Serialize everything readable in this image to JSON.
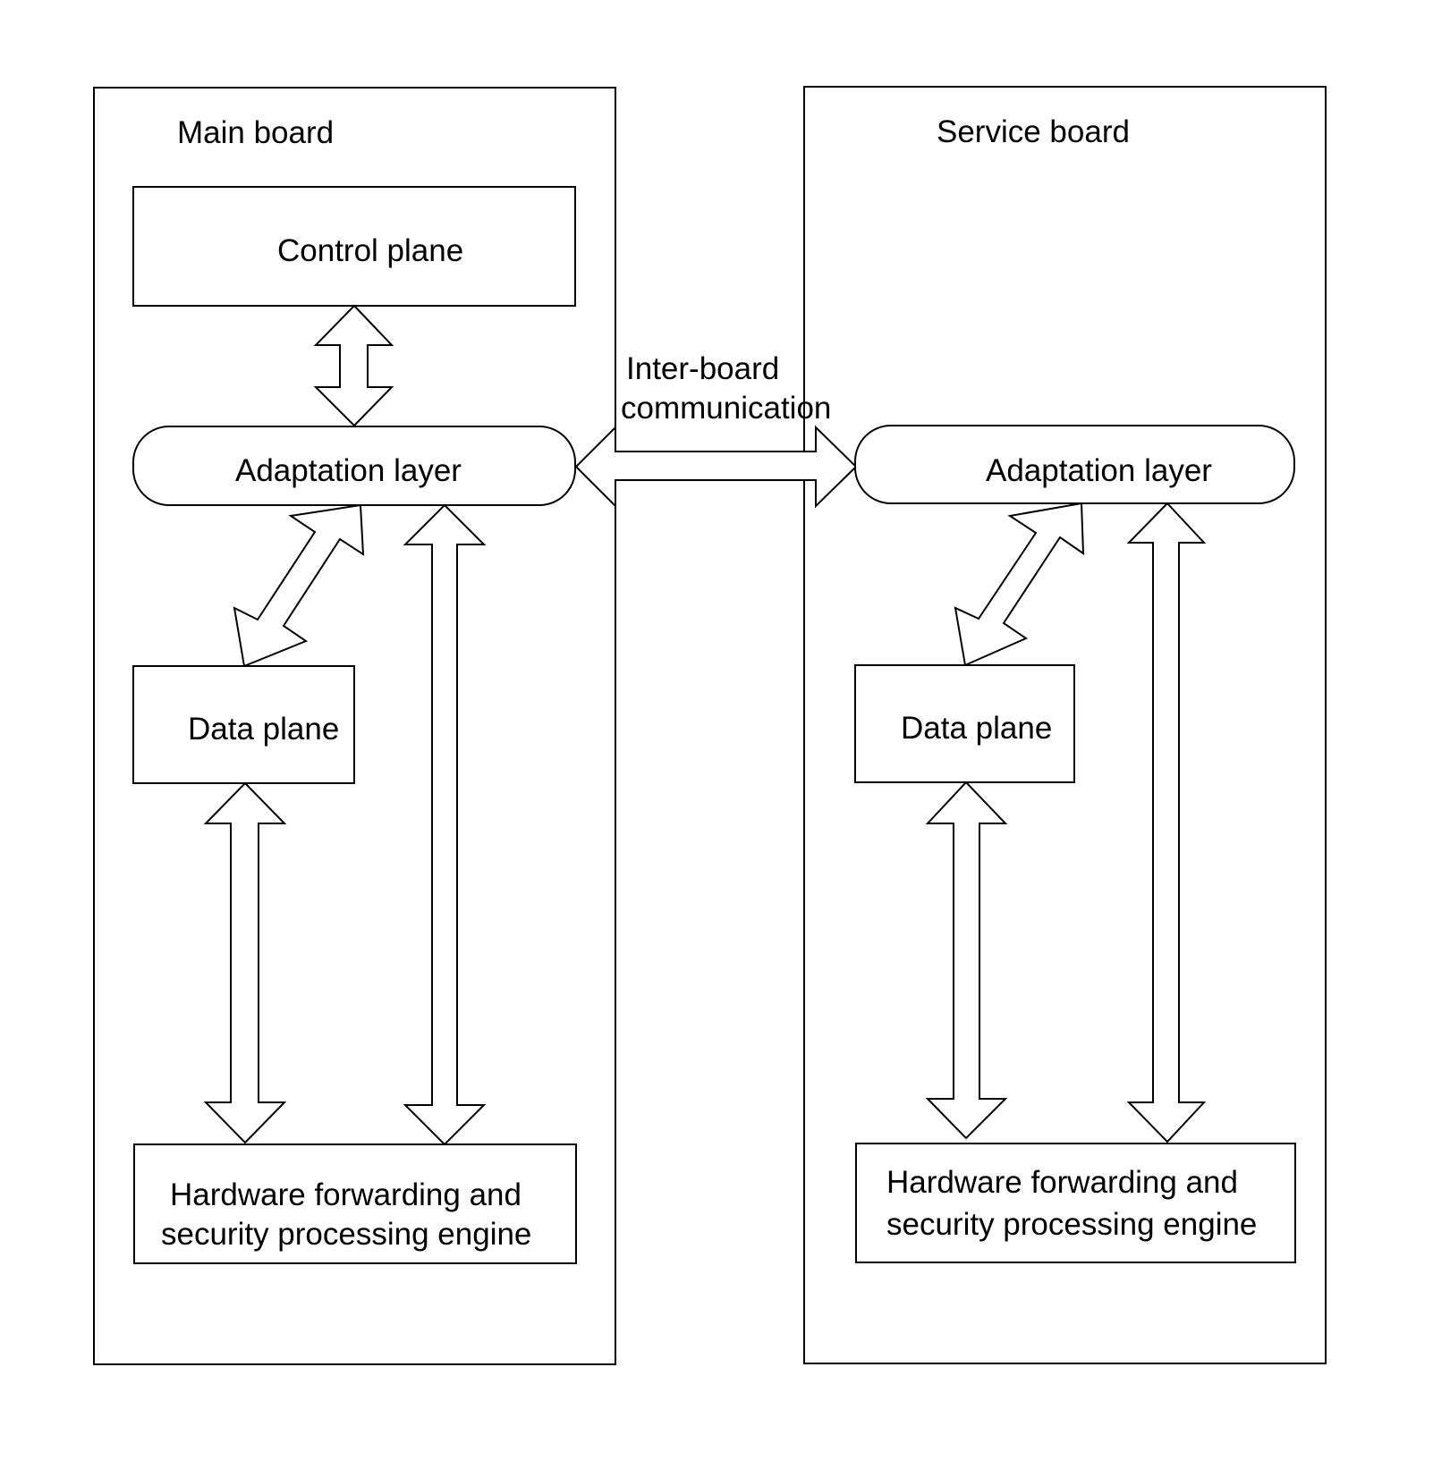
{
  "diagram": {
    "main_board": {
      "title": "Main board",
      "control_plane": "Control plane",
      "adaptation_layer": "Adaptation layer",
      "data_plane": "Data plane",
      "engine_line1": "Hardware forwarding and",
      "engine_line2": "security processing engine"
    },
    "service_board": {
      "title": "Service board",
      "adaptation_layer": "Adaptation layer",
      "data_plane": "Data plane",
      "engine_line1": "Hardware forwarding and",
      "engine_line2": "security processing engine"
    },
    "inter_board": {
      "line1": "Inter-board",
      "line2": "communication"
    }
  }
}
